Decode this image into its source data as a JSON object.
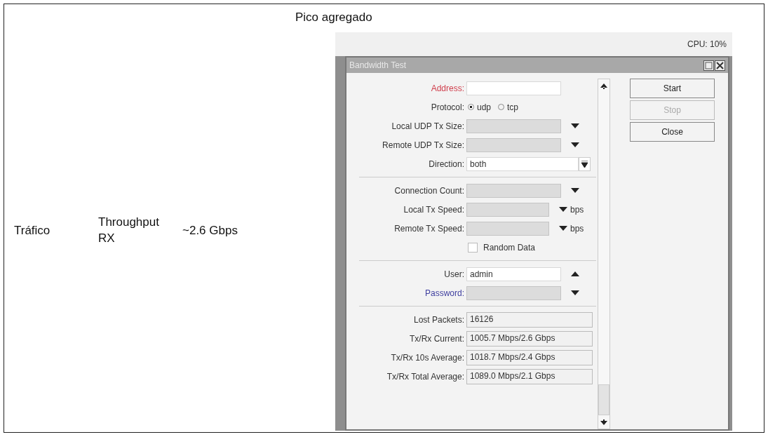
{
  "header": "Pico agregado",
  "row": {
    "category": "Tráfico",
    "metric": "Throughput RX",
    "value": "~2.6 Gbps"
  },
  "screenshot": {
    "cpu": "CPU: 10%",
    "window": {
      "title": "Bandwidth Test",
      "sections": [
        {
          "rows": [
            {
              "kind": "input",
              "label": "Address:",
              "color": "#d0404e",
              "active": true
            },
            {
              "kind": "radio",
              "label": "Protocol:",
              "options": [
                {
                  "label": "udp",
                  "selected": true
                },
                {
                  "label": "tcp",
                  "selected": false
                }
              ]
            },
            {
              "kind": "combo",
              "label": "Local UDP Tx Size:",
              "active": false
            },
            {
              "kind": "combo",
              "label": "Remote UDP Tx Size:",
              "active": false
            },
            {
              "kind": "select",
              "label": "Direction:",
              "value": "both",
              "active": true
            }
          ]
        },
        {
          "rows": [
            {
              "kind": "combo",
              "label": "Connection Count:",
              "active": false
            },
            {
              "kind": "combo",
              "label": "Local Tx Speed:",
              "active": false,
              "unit": "bps"
            },
            {
              "kind": "combo",
              "label": "Remote Tx Speed:",
              "active": false,
              "unit": "bps"
            },
            {
              "kind": "checkbox",
              "label": "Random Data",
              "checked": false
            }
          ]
        },
        {
          "rows": [
            {
              "kind": "expanded",
              "label": "User:",
              "value": "admin",
              "active": true
            },
            {
              "kind": "combo",
              "label": "Password:",
              "color": "#4040a0",
              "active": false
            }
          ]
        },
        {
          "rows": [
            {
              "kind": "readout",
              "label": "Lost Packets:",
              "value": "16126"
            },
            {
              "kind": "readout",
              "label": "Tx/Rx Current:",
              "value": "1005.7 Mbps/2.6 Gbps"
            },
            {
              "kind": "readout",
              "label": "Tx/Rx 10s Average:",
              "value": "1018.7 Mbps/2.4 Gbps"
            },
            {
              "kind": "readout",
              "label": "Tx/Rx Total Average:",
              "value": "1089.0 Mbps/2.1 Gbps"
            }
          ]
        }
      ],
      "buttons": [
        {
          "label": "Start",
          "disabled": false
        },
        {
          "label": "Stop",
          "disabled": true
        },
        {
          "label": "Close",
          "disabled": false
        }
      ]
    }
  }
}
